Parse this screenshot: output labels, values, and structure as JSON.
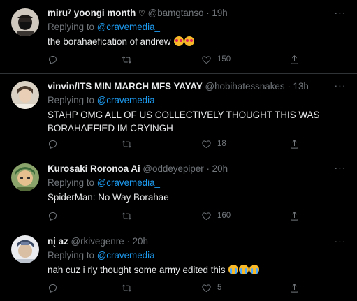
{
  "tweets": [
    {
      "name": "miru",
      "name_sup": "7",
      "name_rest": " yoongi month ",
      "name_icon": "heart-outline-icon",
      "handle": "@bamgtanso",
      "time": "19h",
      "reply_prefix": "Replying to ",
      "reply_to": "@cravemedia_",
      "text": "the borahaefication of andrew",
      "emojis": [
        "smiling-face-with-heart-eyes",
        "smiling-face-with-heart-eyes"
      ],
      "likes": "150"
    },
    {
      "name": "vinvin/ITS MIN MARCH MFS YAYAY",
      "handle": "@hobihatessnakes",
      "time": "13h",
      "reply_prefix": "Replying to ",
      "reply_to": "@cravemedia_",
      "text_line1": "STAHP OMG ALL OF US COLLECTIVELY THOUGHT THIS WAS",
      "text_line2": "BORAHAEFIED IM CRYINGH",
      "likes": "18"
    },
    {
      "name": "Kurosaki Roronoa Ai",
      "handle": "@oddeyepiper",
      "time": "20h",
      "reply_prefix": "Replying to ",
      "reply_to": "@cravemedia_",
      "text": "SpiderMan: No Way Borahae",
      "likes": "160"
    },
    {
      "name": "nį az",
      "handle": "@rkivegenre",
      "time": "20h",
      "reply_prefix": "Replying to ",
      "reply_to": "@cravemedia_",
      "text": "nah cuz i rly thought some army edited this",
      "emojis": [
        "loudly-crying-face",
        "loudly-crying-face",
        "loudly-crying-face"
      ],
      "likes": "5"
    }
  ],
  "separator": "·",
  "more_glyph": "···",
  "colors": {
    "background": "#000000",
    "primary_text": "#e7e9ea",
    "secondary_text": "#71767b",
    "accent": "#1d9bf0",
    "divider": "#2f3336"
  }
}
